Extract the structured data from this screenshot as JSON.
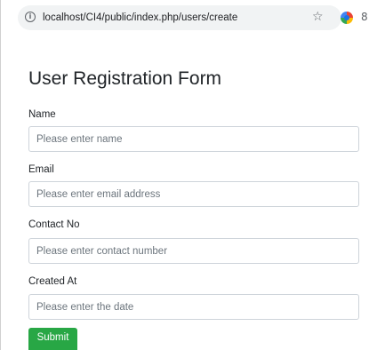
{
  "browser": {
    "url": "localhost/CI4/public/index.php/users/create",
    "info_icon": "info-icon",
    "bookmark_icon": "star-icon",
    "info_glyph": "i",
    "star_glyph": "☆",
    "extension_glyph": "8"
  },
  "form": {
    "title": "User Registration Form",
    "fields": [
      {
        "label": "Name",
        "placeholder": "Please enter name",
        "value": ""
      },
      {
        "label": "Email",
        "placeholder": "Please enter email address",
        "value": ""
      },
      {
        "label": "Contact No",
        "placeholder": "Please enter contact number",
        "value": ""
      },
      {
        "label": "Created At",
        "placeholder": "Please enter the date",
        "value": ""
      }
    ],
    "submit_label": "Submit"
  },
  "colors": {
    "submit_background": "#28a745",
    "input_border": "#ced4da",
    "placeholder_text": "#6c757d"
  }
}
